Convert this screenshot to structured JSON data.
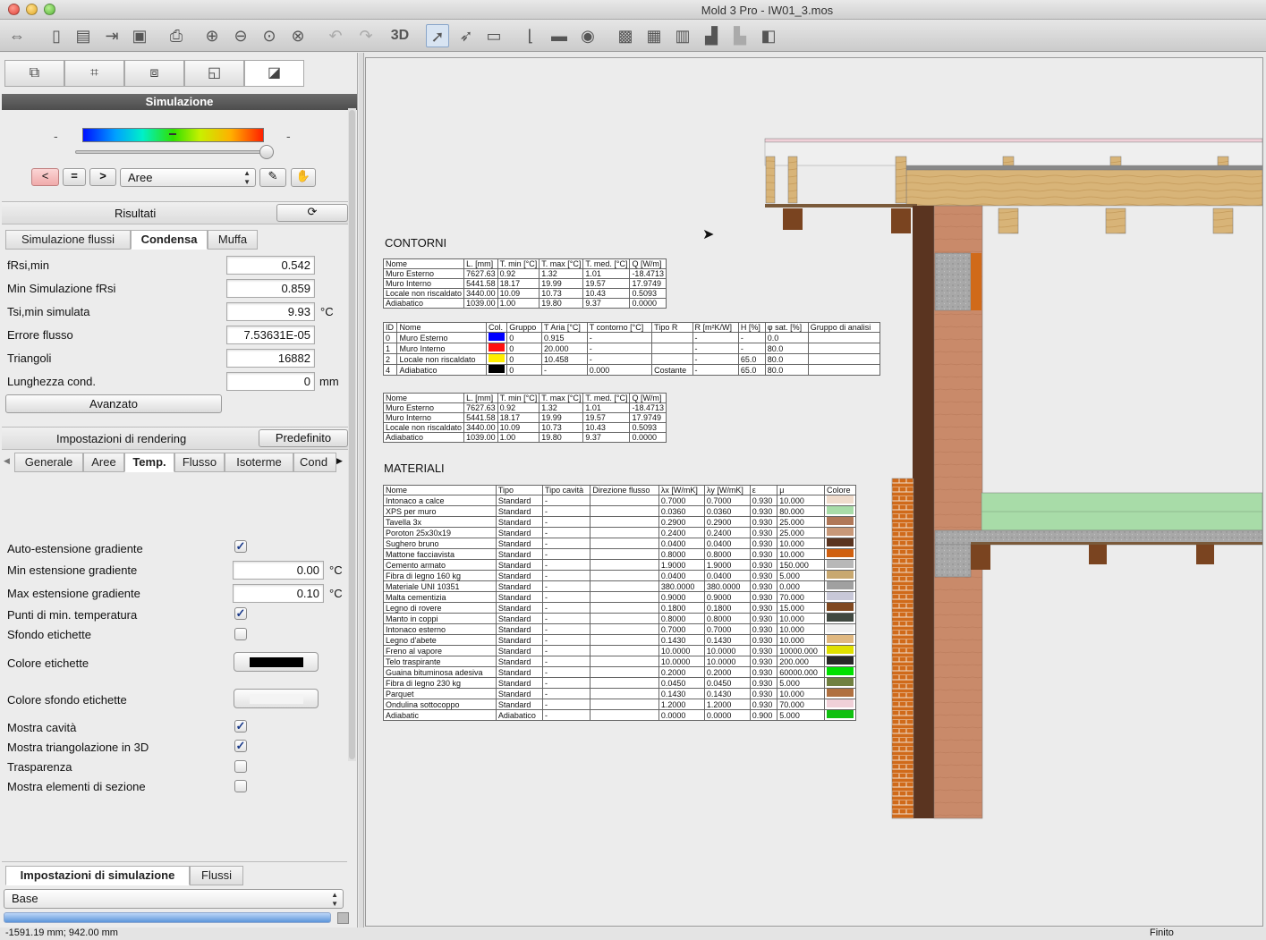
{
  "window": {
    "title": "Mold 3 Pro - IW01_3.mos"
  },
  "toolbar": {
    "mode_3d_label": "3D"
  },
  "left": {
    "section_title": "Simulazione",
    "gradient_min": "-",
    "gradient_max": "-",
    "compare_lt": "<",
    "compare_eq": "=",
    "compare_gt": ">",
    "area_select": "Aree",
    "results_label": "Risultati",
    "result_tabs": [
      "Simulazione flussi",
      "Condensa",
      "Muffa"
    ],
    "results": [
      {
        "label": "fRsi,min",
        "value": "0.542",
        "unit": ""
      },
      {
        "label": "Min Simulazione fRsi",
        "value": "0.859",
        "unit": ""
      },
      {
        "label": "Tsi,min simulata",
        "value": "9.93",
        "unit": "°C"
      },
      {
        "label": "Errore flusso",
        "value": "7.53631E-05",
        "unit": ""
      },
      {
        "label": "Triangoli",
        "value": "16882",
        "unit": ""
      },
      {
        "label": "Lunghezza cond.",
        "value": "0",
        "unit": "mm"
      }
    ],
    "advanced_button": "Avanzato",
    "render_settings_label": "Impostazioni di rendering",
    "default_button": "Predefinito",
    "render_tabs": [
      "Generale",
      "Aree",
      "Temp.",
      "Flusso",
      "Isoterme",
      "Cond"
    ],
    "render_options": {
      "auto_ext": {
        "label": "Auto-estensione gradiente",
        "checked": true
      },
      "min_ext": {
        "label": "Min estensione gradiente",
        "value": "0.00",
        "unit": "°C"
      },
      "max_ext": {
        "label": "Max estensione gradiente",
        "value": "0.10",
        "unit": "°C"
      },
      "min_points": {
        "label": "Punti di min. temperatura",
        "checked": true
      },
      "label_bg": {
        "label": "Sfondo etichette",
        "checked": false
      },
      "label_color": {
        "label": "Colore etichette",
        "color": "#000000"
      },
      "label_bg_color": {
        "label": "Colore sfondo etichette",
        "color": "#f4f4f4"
      },
      "show_cavity": {
        "label": "Mostra cavità",
        "checked": true
      },
      "show_tri3d": {
        "label": "Mostra triangolazione in 3D",
        "checked": true
      },
      "transparency": {
        "label": "Trasparenza",
        "checked": false
      },
      "show_section": {
        "label": "Mostra elementi di sezione",
        "checked": false
      }
    },
    "sim_tabs": [
      "Impostazioni di simulazione",
      "Flussi"
    ],
    "sim_select": "Base"
  },
  "canvas": {
    "contorni_title": "CONTORNI",
    "materiali_title": "MATERIALI",
    "boundary_headers": [
      "Nome",
      "L. [mm]",
      "T. min [°C]",
      "T. max [°C]",
      "T. med. [°C]",
      "Q [W/m]"
    ],
    "boundary_rows": [
      [
        "Muro Esterno",
        "7627.63",
        "0.92",
        "1.32",
        "1.01",
        "-18.4713"
      ],
      [
        "Muro Interno",
        "5441.58",
        "18.17",
        "19.99",
        "19.57",
        "17.9749"
      ],
      [
        "Locale non riscaldato",
        "3440.00",
        "10.09",
        "10.73",
        "10.43",
        "0.5093"
      ],
      [
        "Adiabatico",
        "1039.00",
        "1.00",
        "19.80",
        "9.37",
        "0.0000"
      ]
    ],
    "conditions_headers": [
      "ID",
      "Nome",
      "Col.",
      "Gruppo",
      "T Aria [°C]",
      "T contorno [°C]",
      "Tipo R",
      "R [m²K/W]",
      "H [%]",
      "φ sat. [%]",
      "Gruppo di analisi"
    ],
    "conditions_rows": [
      {
        "id": "0",
        "name": "Muro Esterno",
        "color": "#0000ff",
        "group": "0",
        "tair": "0.915",
        "tcont": "-",
        "rtype": "",
        "r": "-",
        "h": "-",
        "phi": "0.0",
        "ga": ""
      },
      {
        "id": "1",
        "name": "Muro Interno",
        "color": "#ff1010",
        "group": "0",
        "tair": "20.000",
        "tcont": "-",
        "rtype": "",
        "r": "-",
        "h": "-",
        "phi": "80.0",
        "ga": ""
      },
      {
        "id": "2",
        "name": "Locale non riscaldato",
        "color": "#ffee00",
        "group": "0",
        "tair": "10.458",
        "tcont": "-",
        "rtype": "",
        "r": "-",
        "h": "65.0",
        "phi": "80.0",
        "ga": ""
      },
      {
        "id": "4",
        "name": "Adiabatico",
        "color": "#000000",
        "group": "0",
        "tair": "-",
        "tcont": "0.000",
        "rtype": "Costante",
        "r": "-",
        "h": "65.0",
        "phi": "80.0",
        "ga": ""
      }
    ],
    "materials_headers": [
      "Nome",
      "Tipo",
      "Tipo cavità",
      "Direzione flusso",
      "λx [W/mK]",
      "λy [W/mK]",
      "ε",
      "μ",
      "Colore"
    ],
    "materials_rows": [
      {
        "n": "Intonaco a calce",
        "t": "Standard",
        "c": "-",
        "lx": "0.7000",
        "ly": "0.7000",
        "e": "0.930",
        "mu": "10.000",
        "col": "#f0dccc"
      },
      {
        "n": "XPS per muro",
        "t": "Standard",
        "c": "-",
        "lx": "0.0360",
        "ly": "0.0360",
        "e": "0.930",
        "mu": "80.000",
        "col": "#a8dca8"
      },
      {
        "n": "Tavella 3x",
        "t": "Standard",
        "c": "-",
        "lx": "0.2900",
        "ly": "0.2900",
        "e": "0.930",
        "mu": "25.000",
        "col": "#b07858"
      },
      {
        "n": "Poroton 25x30x19",
        "t": "Standard",
        "c": "-",
        "lx": "0.2400",
        "ly": "0.2400",
        "e": "0.930",
        "mu": "25.000",
        "col": "#c89878"
      },
      {
        "n": "Sughero bruno",
        "t": "Standard",
        "c": "-",
        "lx": "0.0400",
        "ly": "0.0400",
        "e": "0.930",
        "mu": "10.000",
        "col": "#5a3420"
      },
      {
        "n": "Mattone facciavista",
        "t": "Standard",
        "c": "-",
        "lx": "0.8000",
        "ly": "0.8000",
        "e": "0.930",
        "mu": "10.000",
        "col": "#d06010"
      },
      {
        "n": "Cemento armato",
        "t": "Standard",
        "c": "-",
        "lx": "1.9000",
        "ly": "1.9000",
        "e": "0.930",
        "mu": "150.000",
        "col": "#b8b8b8"
      },
      {
        "n": "Fibra di legno 160 kg",
        "t": "Standard",
        "c": "-",
        "lx": "0.0400",
        "ly": "0.0400",
        "e": "0.930",
        "mu": "5.000",
        "col": "#c8a870"
      },
      {
        "n": "Materiale UNI 10351",
        "t": "Standard",
        "c": "-",
        "lx": "380.0000",
        "ly": "380.0000",
        "e": "0.930",
        "mu": "0.000",
        "col": "#a0a0a0"
      },
      {
        "n": "Malta cementizia",
        "t": "Standard",
        "c": "-",
        "lx": "0.9000",
        "ly": "0.9000",
        "e": "0.930",
        "mu": "70.000",
        "col": "#c8c8d8"
      },
      {
        "n": "Legno di rovere",
        "t": "Standard",
        "c": "-",
        "lx": "0.1800",
        "ly": "0.1800",
        "e": "0.930",
        "mu": "15.000",
        "col": "#804820"
      },
      {
        "n": "Manto in coppi",
        "t": "Standard",
        "c": "-",
        "lx": "0.8000",
        "ly": "0.8000",
        "e": "0.930",
        "mu": "10.000",
        "col": "#404840"
      },
      {
        "n": "Intonaco esterno",
        "t": "Standard",
        "c": "-",
        "lx": "0.7000",
        "ly": "0.7000",
        "e": "0.930",
        "mu": "10.000",
        "col": "#f0f0f0"
      },
      {
        "n": "Legno d'abete",
        "t": "Standard",
        "c": "-",
        "lx": "0.1430",
        "ly": "0.1430",
        "e": "0.930",
        "mu": "10.000",
        "col": "#e0b880"
      },
      {
        "n": "Freno al vapore",
        "t": "Standard",
        "c": "-",
        "lx": "10.0000",
        "ly": "10.0000",
        "e": "0.930",
        "mu": "10000.000",
        "col": "#e0e000"
      },
      {
        "n": "Telo traspirante",
        "t": "Standard",
        "c": "-",
        "lx": "10.0000",
        "ly": "10.0000",
        "e": "0.930",
        "mu": "200.000",
        "col": "#282828"
      },
      {
        "n": "Guaina bituminosa adesiva",
        "t": "Standard",
        "c": "-",
        "lx": "0.2000",
        "ly": "0.2000",
        "e": "0.930",
        "mu": "60000.000",
        "col": "#00e000"
      },
      {
        "n": "Fibra di legno 230 kg",
        "t": "Standard",
        "c": "-",
        "lx": "0.0450",
        "ly": "0.0450",
        "e": "0.930",
        "mu": "5.000",
        "col": "#708040"
      },
      {
        "n": "Parquet",
        "t": "Standard",
        "c": "-",
        "lx": "0.1430",
        "ly": "0.1430",
        "e": "0.930",
        "mu": "10.000",
        "col": "#b07040"
      },
      {
        "n": "Ondulina sottocoppo",
        "t": "Standard",
        "c": "-",
        "lx": "1.2000",
        "ly": "1.2000",
        "e": "0.930",
        "mu": "70.000",
        "col": "#f0d0d8"
      },
      {
        "n": "Adiabatic",
        "t": "Adiabatico",
        "c": "-",
        "lx": "0.0000",
        "ly": "0.0000",
        "e": "0.900",
        "mu": "5.000",
        "col": "#10c010"
      }
    ]
  },
  "status": {
    "coords": "-1591.19 mm; 942.00 mm",
    "state": "Finito"
  }
}
